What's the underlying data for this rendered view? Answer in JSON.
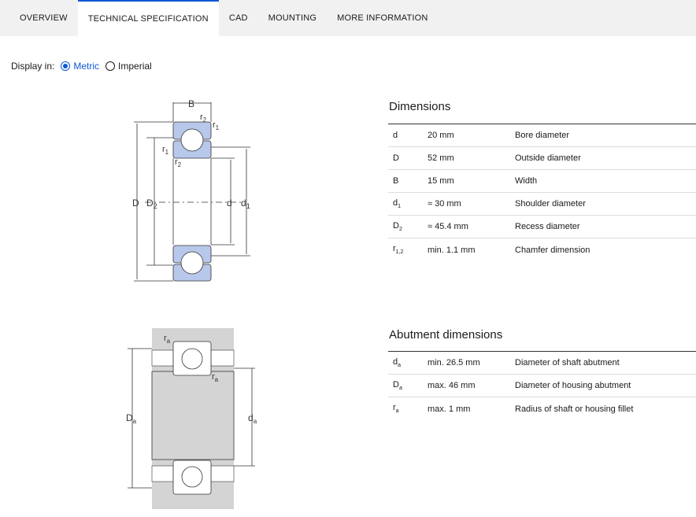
{
  "tabs": [
    {
      "label": "OVERVIEW"
    },
    {
      "label": "TECHNICAL SPECIFICATION"
    },
    {
      "label": "CAD"
    },
    {
      "label": "MOUNTING"
    },
    {
      "label": "MORE INFORMATION"
    }
  ],
  "display": {
    "label": "Display in:",
    "metric": "Metric",
    "imperial": "Imperial",
    "selected": "Metric"
  },
  "colors": {
    "accent": "#0f58d6",
    "ring_fill": "#b7c8ea",
    "housing_fill": "#d4d4d4"
  },
  "drawing1": {
    "B": "B",
    "r": "r",
    "s1": "1",
    "s2": "2",
    "D": "D",
    "d": "d"
  },
  "drawing2": {
    "r": "r",
    "a": "a",
    "D": "D",
    "d": "d"
  },
  "dimensions": {
    "title": "Dimensions",
    "rows": [
      {
        "sym": "d",
        "sub": "",
        "value": "20 mm",
        "desc": "Bore diameter"
      },
      {
        "sym": "D",
        "sub": "",
        "value": "52 mm",
        "desc": "Outside diameter"
      },
      {
        "sym": "B",
        "sub": "",
        "value": "15 mm",
        "desc": "Width"
      },
      {
        "sym": "d",
        "sub": "1",
        "value": "≈ 30 mm",
        "desc": "Shoulder diameter"
      },
      {
        "sym": "D",
        "sub": "2",
        "value": "≈ 45.4 mm",
        "desc": "Recess diameter"
      },
      {
        "sym": "r",
        "sub": "1,2",
        "value": "min. 1.1 mm",
        "desc": "Chamfer dimension"
      }
    ]
  },
  "abutment": {
    "title": "Abutment dimensions",
    "rows": [
      {
        "sym": "d",
        "sub": "a",
        "value": "min. 26.5 mm",
        "desc": "Diameter of shaft abutment"
      },
      {
        "sym": "D",
        "sub": "a",
        "value": "max. 46 mm",
        "desc": "Diameter of housing abutment"
      },
      {
        "sym": "r",
        "sub": "a",
        "value": "max. 1 mm",
        "desc": "Radius of shaft or housing fillet"
      }
    ]
  }
}
